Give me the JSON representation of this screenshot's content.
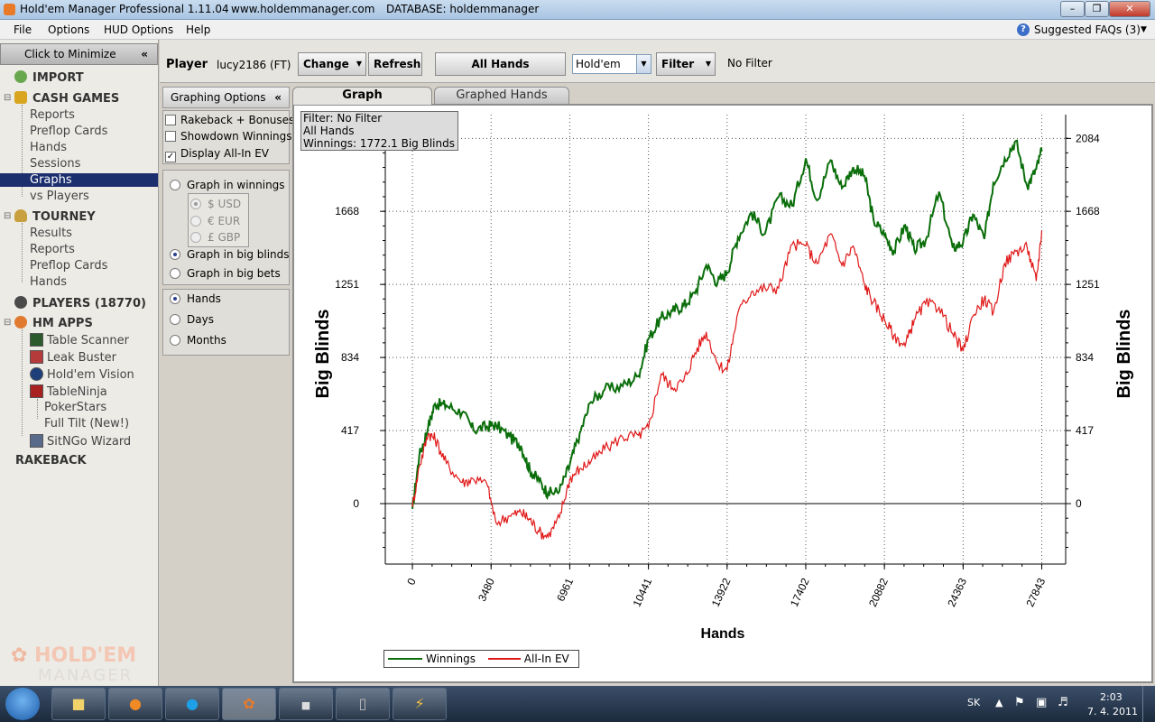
{
  "window": {
    "title": "Hold'em Manager Professional 1.11.04",
    "url": "www.holdemmanager.com",
    "database": "DATABASE: holdemmanager"
  },
  "menu": [
    "File",
    "Options",
    "HUD Options",
    "Help"
  ],
  "faq": "Suggested FAQs (3)",
  "sidebar": {
    "minimize_label": "Click to Minimize",
    "import": "IMPORT",
    "cash_games": "CASH GAMES",
    "cash_items": [
      "Reports",
      "Preflop Cards",
      "Hands",
      "Sessions",
      "Graphs",
      "vs Players"
    ],
    "tourney": "TOURNEY",
    "tourney_items": [
      "Results",
      "Reports",
      "Preflop Cards",
      "Hands"
    ],
    "players": "PLAYERS (18770)",
    "hm_apps": "HM APPS",
    "apps": [
      "Table Scanner",
      "Leak Buster",
      "Hold'em Vision",
      "TableNinja"
    ],
    "tableninja_items": [
      "PokerStars",
      "Full Tilt (New!)"
    ],
    "sitngo": "SitNGo Wizard",
    "rakeback": "RAKEBACK",
    "logo_top": "HOLD'EM",
    "logo_bottom": "MANAGER"
  },
  "playerbar": {
    "label": "Player",
    "player": "lucy2186 (FT)",
    "change": "Change",
    "refresh": "Refresh",
    "all_hands": "All Hands",
    "game": "Hold'em",
    "filter": "Filter",
    "filter_status": "No Filter"
  },
  "graphing_options": {
    "title": "Graphing Options",
    "checkboxes": [
      {
        "label": "Rakeback + Bonuses",
        "checked": false
      },
      {
        "label": "Showdown Winnings",
        "checked": false
      },
      {
        "label": "Display All-In EV",
        "checked": true
      }
    ],
    "graph_in_winnings": "Graph in winnings",
    "currencies": [
      "$ USD",
      "€ EUR",
      "£ GBP"
    ],
    "graph_in_big_blinds": "Graph in big blinds",
    "graph_in_big_bets": "Graph in big bets",
    "xaxis_modes": [
      "Hands",
      "Days",
      "Months"
    ]
  },
  "tabs": [
    "Graph",
    "Graphed Hands"
  ],
  "info": {
    "filter": "Filter: No Filter",
    "hands": "All Hands",
    "winnings": "Winnings: 1772.1 Big Blinds"
  },
  "chart_data": {
    "type": "line",
    "xlabel": "Hands",
    "ylabel": "Big Blinds",
    "x_ticks": [
      0,
      3480,
      6961,
      10441,
      13922,
      17402,
      20882,
      24363,
      27843
    ],
    "y_ticks": [
      0,
      417,
      834,
      1251,
      1668,
      2084
    ],
    "xlim": [
      -1200,
      28900
    ],
    "ylim": [
      -345,
      2220
    ],
    "grid": true,
    "legend_placement": "bottom-left",
    "series": [
      {
        "name": "Winnings",
        "color": "#0a6e0a",
        "x": [
          0,
          300,
          700,
          1000,
          1500,
          2200,
          2700,
          3300,
          3700,
          4300,
          4800,
          5200,
          5600,
          6000,
          6500,
          6961,
          7400,
          7900,
          8500,
          9300,
          10000,
          10441,
          11000,
          11500,
          12000,
          12500,
          13000,
          13500,
          13922,
          14400,
          15000,
          15600,
          16200,
          16800,
          17402,
          17900,
          18500,
          19000,
          19500,
          20000,
          20400,
          20882,
          21300,
          21800,
          22200,
          22700,
          23300,
          23900,
          24363,
          24800,
          25300,
          25700,
          26200,
          26700,
          27200,
          27600,
          27843
        ],
        "y": [
          -30,
          270,
          440,
          570,
          560,
          520,
          420,
          440,
          450,
          380,
          330,
          190,
          130,
          60,
          70,
          220,
          400,
          580,
          650,
          670,
          730,
          940,
          1060,
          1100,
          1130,
          1200,
          1360,
          1260,
          1320,
          1520,
          1660,
          1540,
          1750,
          1700,
          1970,
          1730,
          1960,
          1800,
          1920,
          1870,
          1620,
          1530,
          1440,
          1590,
          1450,
          1500,
          1780,
          1460,
          1490,
          1650,
          1510,
          1830,
          1970,
          2070,
          1810,
          1910,
          2010
        ]
      },
      {
        "name": "All-In EV",
        "color": "#e01818",
        "x": [
          0,
          300,
          700,
          1000,
          1500,
          2200,
          2700,
          3300,
          3700,
          4300,
          4800,
          5200,
          5600,
          6000,
          6500,
          6961,
          7400,
          7900,
          8500,
          9300,
          10000,
          10441,
          11000,
          11500,
          12000,
          12500,
          13000,
          13500,
          13922,
          14400,
          15000,
          15600,
          16200,
          16800,
          17402,
          17900,
          18500,
          19000,
          19500,
          20000,
          20400,
          20882,
          21300,
          21800,
          22200,
          22700,
          23300,
          23900,
          24363,
          24800,
          25300,
          25700,
          26200,
          26700,
          27200,
          27600,
          27843
        ],
        "y": [
          -20,
          210,
          400,
          370,
          230,
          120,
          140,
          110,
          -110,
          -70,
          -50,
          -90,
          -160,
          -190,
          -80,
          140,
          200,
          240,
          310,
          380,
          390,
          430,
          740,
          660,
          700,
          860,
          980,
          800,
          760,
          1090,
          1210,
          1230,
          1230,
          1480,
          1470,
          1370,
          1540,
          1360,
          1470,
          1250,
          1150,
          1050,
          960,
          900,
          1050,
          1140,
          1120,
          970,
          870,
          1070,
          1170,
          1090,
          1370,
          1440,
          1460,
          1270,
          1560
        ]
      }
    ]
  },
  "taskbar": {
    "lang": "SK",
    "time": "2:03",
    "date": "7. 4. 2011"
  }
}
